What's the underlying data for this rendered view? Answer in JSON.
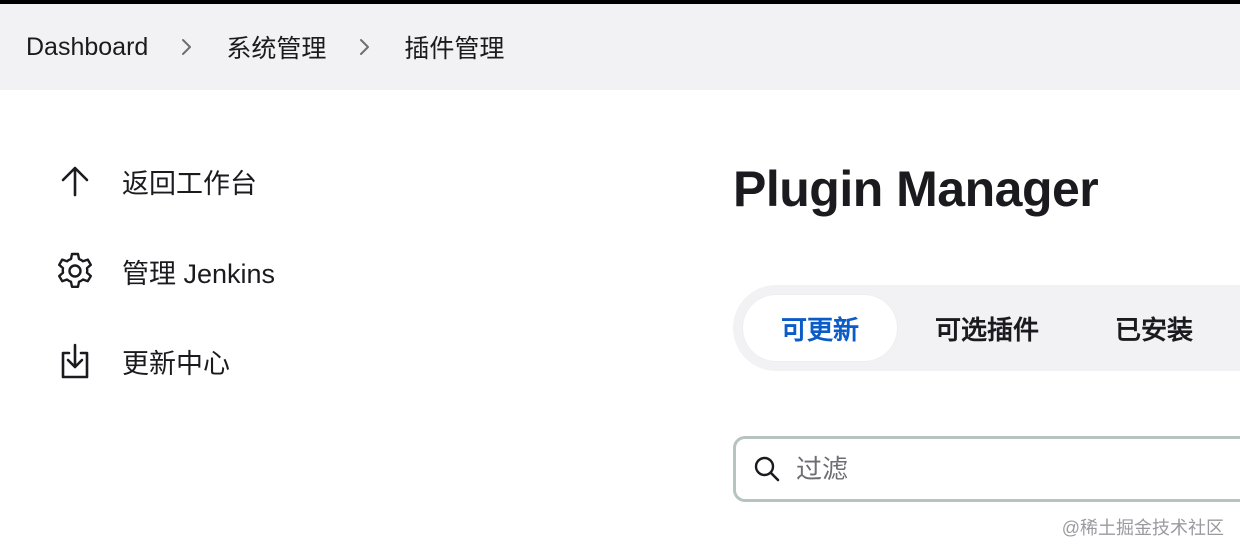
{
  "breadcrumb": {
    "items": [
      {
        "label": "Dashboard"
      },
      {
        "label": "系统管理"
      },
      {
        "label": "插件管理"
      }
    ]
  },
  "sidebar": {
    "items": [
      {
        "label": "返回工作台",
        "icon": "arrow-up-icon"
      },
      {
        "label": "管理 Jenkins",
        "icon": "gear-icon"
      },
      {
        "label": "更新中心",
        "icon": "download-icon"
      }
    ]
  },
  "main": {
    "title": "Plugin Manager",
    "tabs": [
      {
        "label": "可更新",
        "active": true
      },
      {
        "label": "可选插件",
        "active": false
      },
      {
        "label": "已安装",
        "active": false
      }
    ],
    "filter": {
      "placeholder": "过滤",
      "value": ""
    }
  },
  "watermark": "@稀土掘金技术社区",
  "colors": {
    "breadcrumb_bg": "#f2f2f5",
    "active_tab_text": "#0b5cc6",
    "text": "#1b1b1f"
  }
}
